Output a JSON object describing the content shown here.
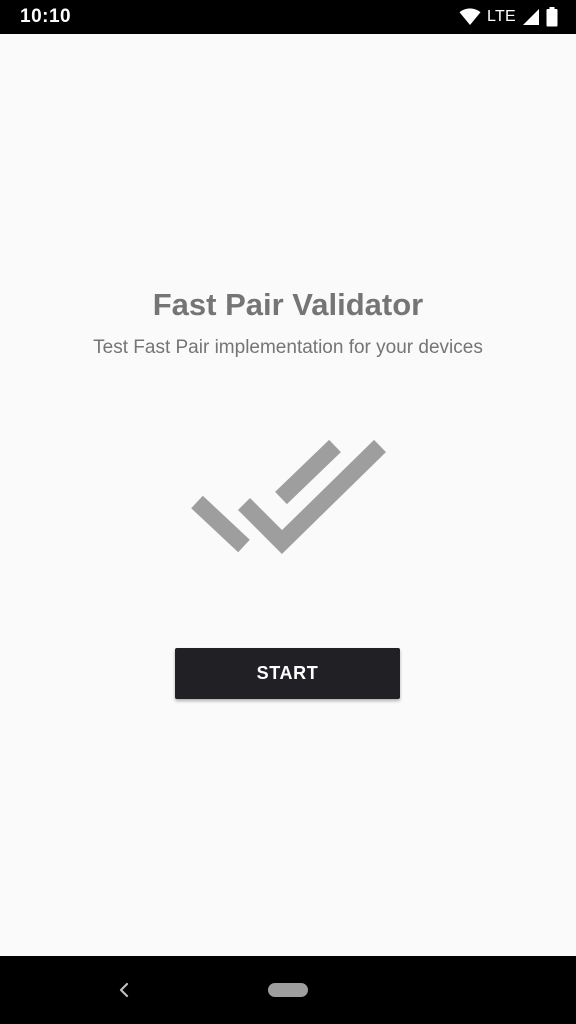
{
  "status_bar": {
    "time": "10:10",
    "network_label": "LTE",
    "icons": [
      "wifi-icon",
      "cell-signal-icon",
      "battery-icon"
    ]
  },
  "main": {
    "title": "Fast Pair Validator",
    "subtitle": "Test Fast Pair implementation for your devices",
    "logo_icon": "double-check-icon",
    "start_label": "START"
  },
  "nav_bar": {
    "icons": [
      "back-icon",
      "home-pill"
    ]
  },
  "colors": {
    "background": "#fafafa",
    "text_gray": "#757575",
    "logo_gray": "#9e9e9e",
    "button_bg": "#212025",
    "bar_black": "#000000"
  }
}
